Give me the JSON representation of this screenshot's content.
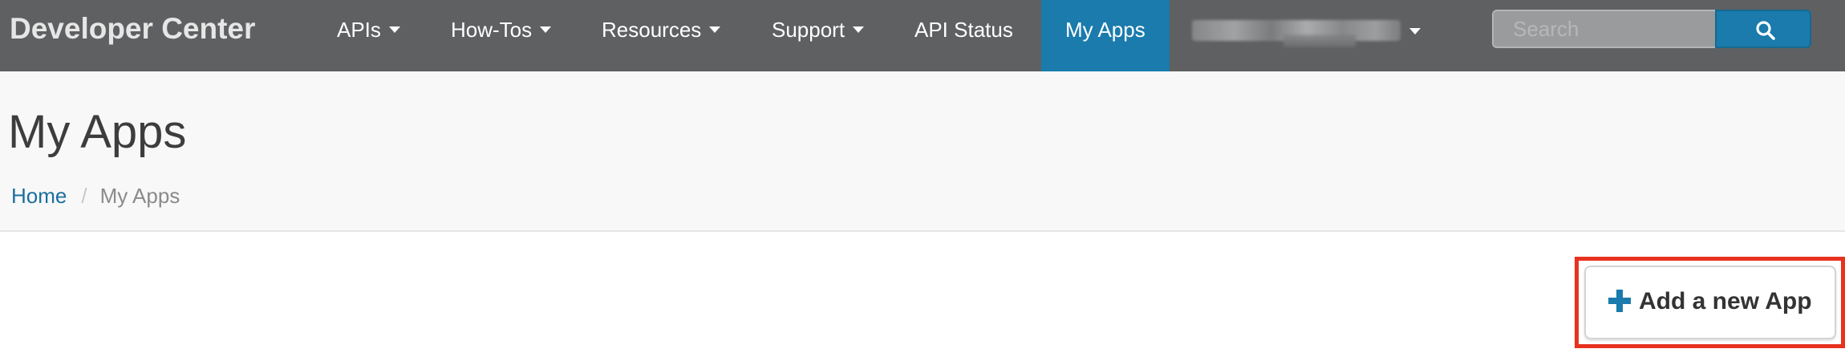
{
  "navbar": {
    "brand": "Developer Center",
    "items": [
      {
        "label": "APIs",
        "has_dropdown": true
      },
      {
        "label": "How-Tos",
        "has_dropdown": true
      },
      {
        "label": "Resources",
        "has_dropdown": true
      },
      {
        "label": "Support",
        "has_dropdown": true
      },
      {
        "label": "API Status",
        "has_dropdown": false
      },
      {
        "label": "My Apps",
        "has_dropdown": false,
        "active": true
      }
    ],
    "user_menu_icon": "chevron-down-icon",
    "search": {
      "placeholder": "Search",
      "button_icon": "search-icon"
    },
    "colors": {
      "bar": "#5f6062",
      "active": "#1a7bac"
    }
  },
  "page": {
    "title": "My Apps",
    "breadcrumb": {
      "home": "Home",
      "separator": "/",
      "current": "My Apps"
    }
  },
  "actions": {
    "add_app_label": "Add a new App",
    "add_app_icon": "plus-icon",
    "highlight_color": "#e8321f"
  }
}
